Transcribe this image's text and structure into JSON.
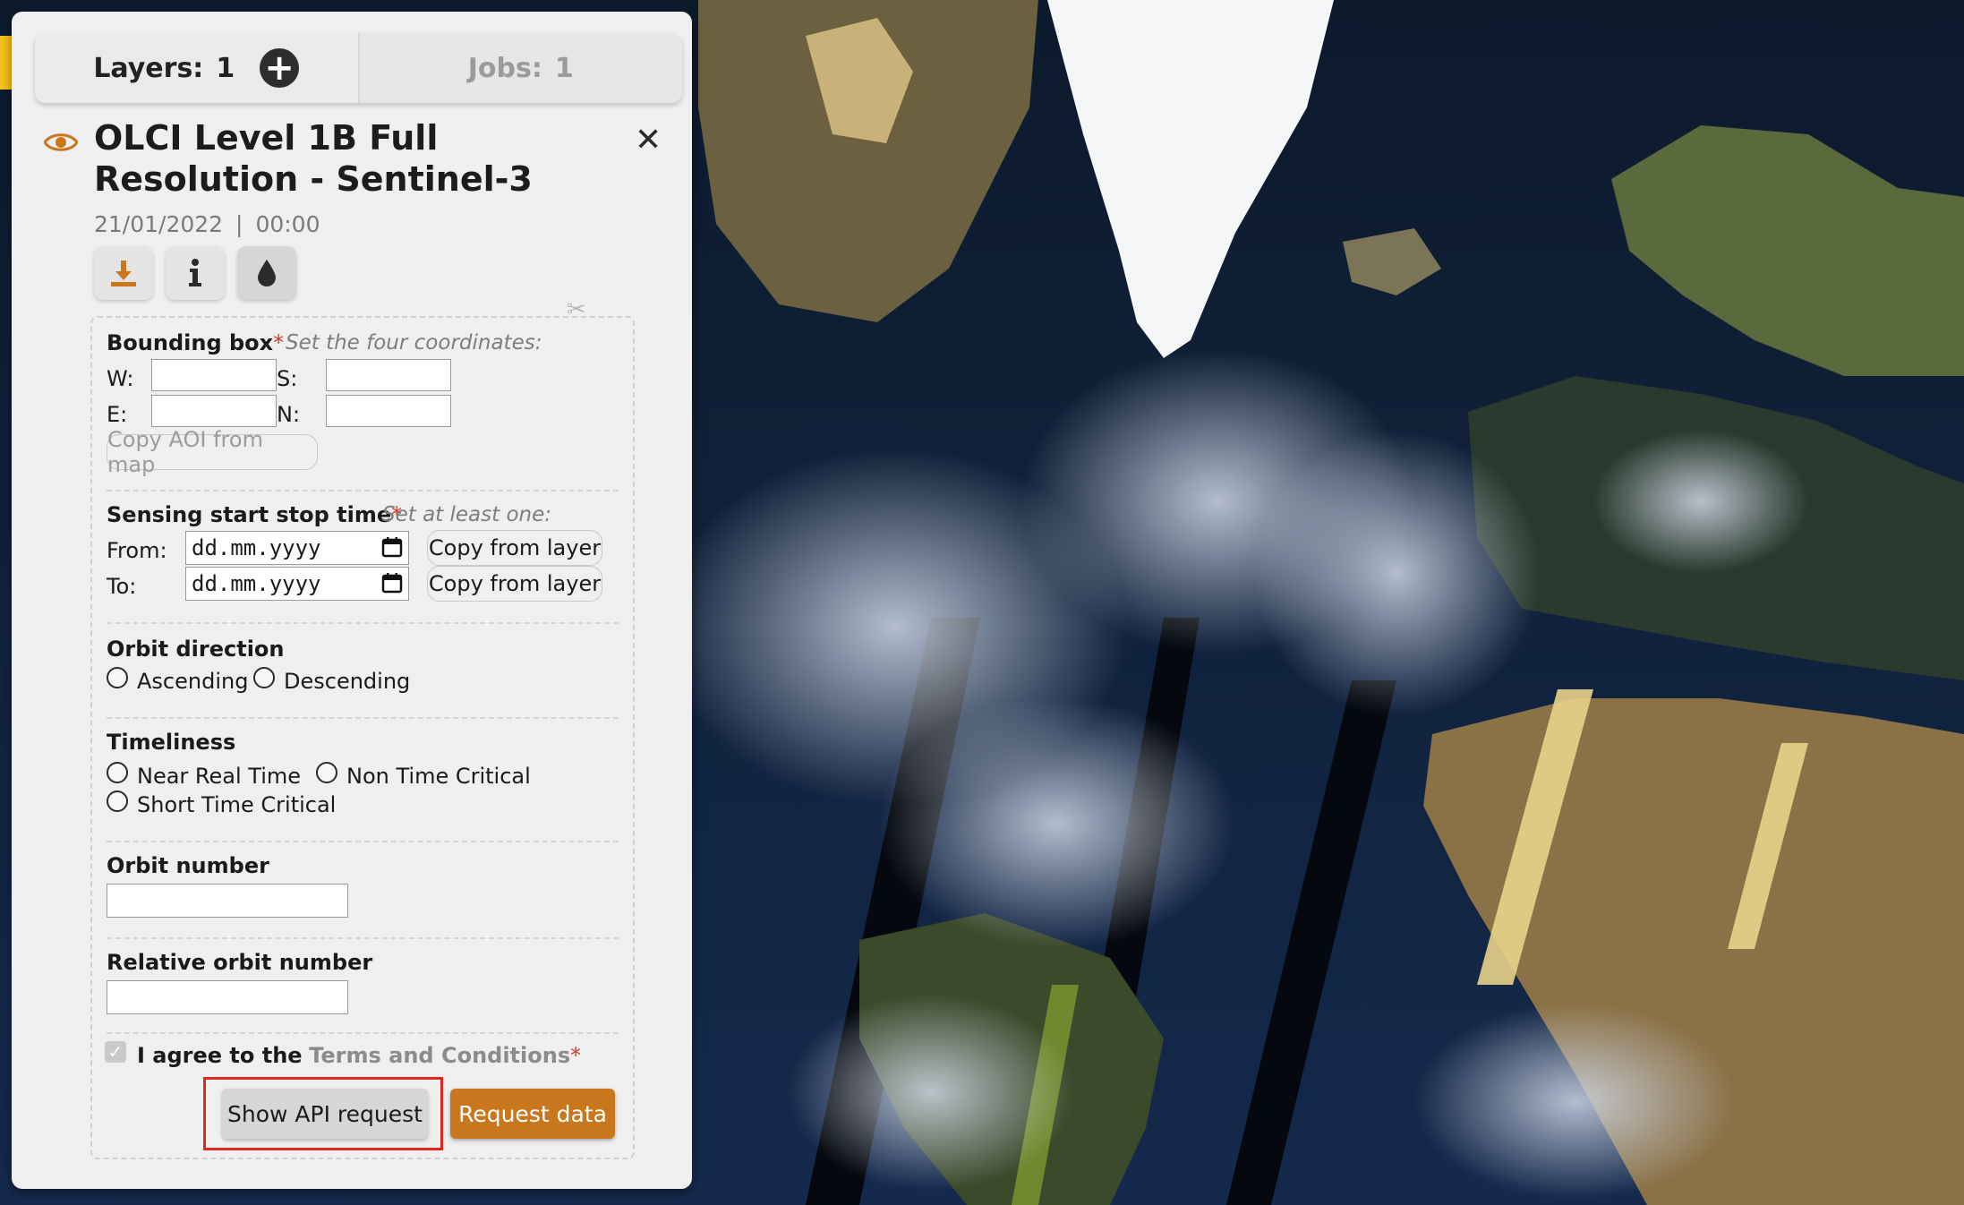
{
  "tabs": {
    "layers_label": "Layers:",
    "layers_count": "1",
    "jobs_label": "Jobs:",
    "jobs_count": "1"
  },
  "layer": {
    "title": "OLCI Level 1B Full Resolution - Sentinel-3",
    "date": "21/01/2022",
    "separator": "|",
    "time": "00:00",
    "tools": [
      {
        "icon": "download-icon"
      },
      {
        "icon": "info-icon"
      },
      {
        "icon": "water-drop-icon"
      }
    ]
  },
  "form": {
    "bbox": {
      "label": "Bounding box",
      "required_mark": "*",
      "hint": "Set the four coordinates:",
      "w_label": "W:",
      "s_label": "S:",
      "e_label": "E:",
      "n_label": "N:",
      "w_value": "",
      "s_value": "",
      "e_value": "",
      "n_value": "",
      "copy_aoi_label": "Copy AOI from map"
    },
    "sensing": {
      "label": "Sensing start stop time",
      "required_mark": "*",
      "hint": "Set at least one:",
      "from_label": "From:",
      "to_label": "To:",
      "from_placeholder": "dd.mm.yyyy",
      "to_placeholder": "dd.mm.yyyy",
      "copy_from_layer_label": "Copy from layer"
    },
    "orbit_direction": {
      "label": "Orbit direction",
      "options": [
        "Ascending",
        "Descending"
      ]
    },
    "timeliness": {
      "label": "Timeliness",
      "options": [
        "Near Real Time",
        "Non Time Critical",
        "Short Time Critical"
      ]
    },
    "orbit_number": {
      "label": "Orbit number",
      "value": ""
    },
    "relative_orbit_number": {
      "label": "Relative orbit number",
      "value": ""
    },
    "agree": {
      "prefix": "I agree to the",
      "link": "Terms and Conditions",
      "required_mark": "*",
      "checked": true
    },
    "show_api_label": "Show API request",
    "request_data_label": "Request data"
  },
  "colors": {
    "accent": "#c9771c",
    "required": "#d13c26",
    "highlight": "#e1261c"
  }
}
